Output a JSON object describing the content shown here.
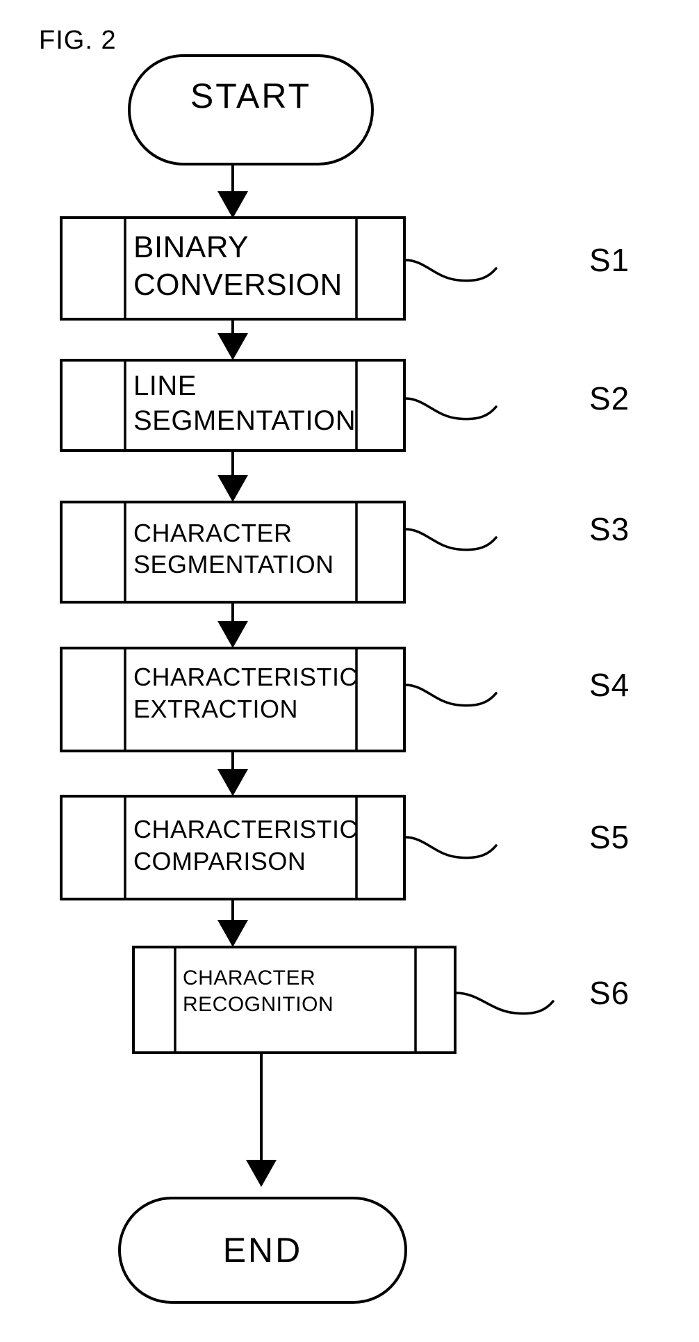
{
  "figure": {
    "label": "FIG. 2",
    "title_text": "FIG. 2"
  },
  "terminals": {
    "start": {
      "label": "START",
      "shape": "stadium"
    },
    "end": {
      "label": "END",
      "shape": "stadium"
    }
  },
  "steps": [
    {
      "ref": "S1",
      "line1": "BINARY",
      "line2": "CONVERSION",
      "shape": "predefined-process"
    },
    {
      "ref": "S2",
      "line1": "LINE",
      "line2": "SEGMENTATION",
      "shape": "predefined-process"
    },
    {
      "ref": "S3",
      "line1": "CHARACTER",
      "line2": "SEGMENTATION",
      "shape": "predefined-process"
    },
    {
      "ref": "S4",
      "line1": "CHARACTERISTIC",
      "line2": "EXTRACTION",
      "shape": "predefined-process"
    },
    {
      "ref": "S5",
      "line1": "CHARACTERISTIC",
      "line2": "COMPARISON",
      "shape": "predefined-process"
    },
    {
      "ref": "S6",
      "line1": "CHARACTER",
      "line2": "RECOGNITION",
      "shape": "predefined-process"
    }
  ],
  "style": {
    "ink_color": "#000000",
    "paper_color": "#ffffff"
  }
}
